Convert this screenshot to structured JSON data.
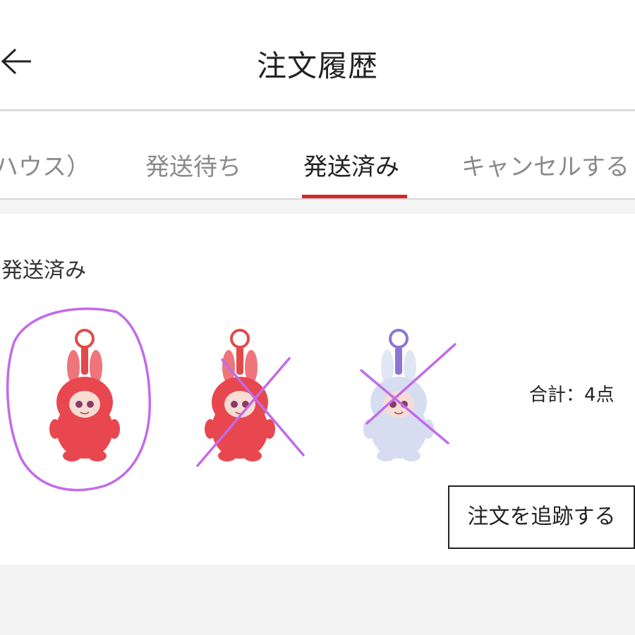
{
  "header": {
    "title": "注文履歴"
  },
  "tabs": [
    {
      "label": "ハウス）"
    },
    {
      "label": "発送待ち"
    },
    {
      "label": "発送済み"
    },
    {
      "label": "キャンセルする"
    }
  ],
  "order": {
    "status": "発送済み",
    "total": "合計：4点",
    "track_button": "注文を追跡する",
    "items": [
      {
        "body_color": "#e8474f",
        "ring_color": "#e24a4a"
      },
      {
        "body_color": "#e8474f",
        "ring_color": "#e24a4a"
      },
      {
        "body_color": "#d7ddf1",
        "ring_color": "#8b76d6"
      }
    ]
  },
  "annotation_color": "#c26be8"
}
